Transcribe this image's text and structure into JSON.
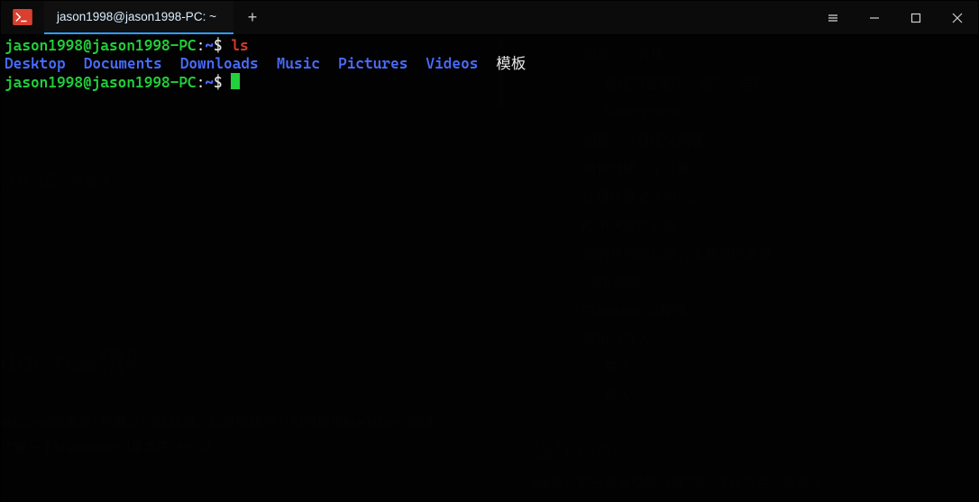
{
  "window": {
    "tab_title": "jason1998@jason1998-PC: ~",
    "new_tab_glyph": "+"
  },
  "terminal": {
    "prompt_userhost": "jason1998@jason1998-PC",
    "prompt_sep": ":",
    "prompt_path": "~",
    "prompt_dollar": "$",
    "cmd1": "ls",
    "dirs": [
      "Desktop",
      "Documents",
      "Downloads",
      "Music",
      "Pictures",
      "Videos",
      "模板"
    ]
  },
  "background": {
    "frag1": ",才执行后一条命令",
    "heading": "down编辑器",
    "para": "arkdown编辑器\" 所展示的欢迎页。如果你想学习如何使用Markdown编辑\n了解一下Markdown的基本语法知识。",
    "toc": [
      {
        "text": "创建一个表格",
        "indent": 0
      },
      {
        "text": "设定内容居中、居左、居右",
        "indent": 1
      },
      {
        "text": "SmartyPants",
        "indent": 1
      },
      {
        "text": "创建一个自定义列表",
        "indent": 0
      },
      {
        "text": "如何创建一个注脚",
        "indent": 0
      },
      {
        "text": "注释也是必不可少的",
        "indent": 0
      },
      {
        "text": "KaTeX数学公式",
        "indent": 0
      },
      {
        "text": "新的甘特图功能，丰富你的文章",
        "indent": 0
      },
      {
        "text": "UML 图表",
        "indent": 0
      },
      {
        "text": "FLowchart流程图",
        "indent": 0
      },
      {
        "text": "导出与导入",
        "indent": 0
      },
      {
        "text": "导出",
        "indent": 1
      },
      {
        "text": "导入",
        "indent": 1
      }
    ],
    "heading2": "操作符&&",
    "para2": "&&表示前一条命令执行成功时,才执行后一条命令"
  }
}
